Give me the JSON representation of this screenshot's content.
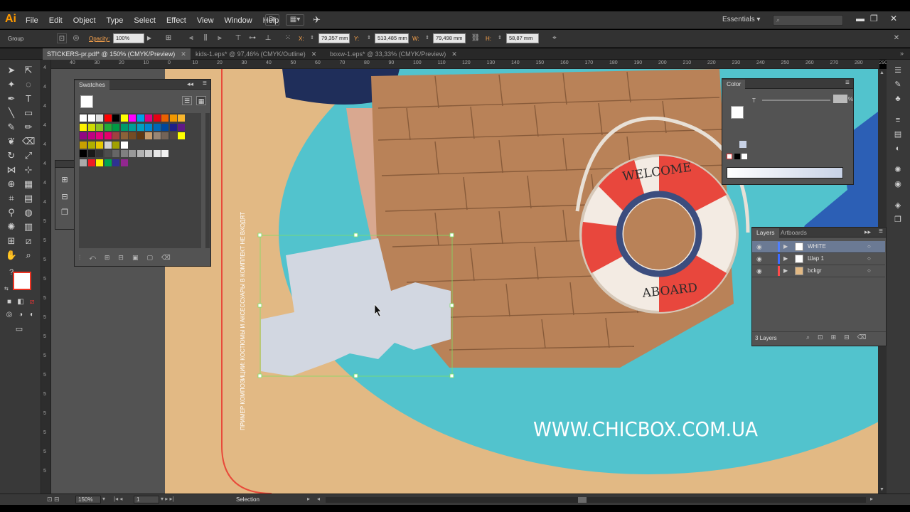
{
  "app": {
    "logo": "Ai",
    "menus": [
      "File",
      "Edit",
      "Object",
      "Type",
      "Select",
      "Effect",
      "View",
      "Window",
      "Help"
    ],
    "workspace": "Essentials",
    "workspace_chevron": "▾",
    "search_icon": "search-icon",
    "window_controls": {
      "minimize": "▬",
      "maximize": "❐",
      "close": "✕"
    }
  },
  "control_bar": {
    "selection_label": "Group",
    "opacity_label": "Opacity:",
    "opacity_value": "100%",
    "x_label": "X:",
    "x_value": "79,357 mm",
    "y_label": "Y:",
    "y_value": "513,485 mm",
    "w_label": "W:",
    "w_value": "79,498 mm",
    "h_label": "H:",
    "h_value": "58,87 mm",
    "close_icon": "✕"
  },
  "tabs": [
    {
      "label": "STICKERS-pr.pdf* @ 150% (CMYK/Preview)",
      "active": true
    },
    {
      "label": "kids-1.eps* @ 97,46% (CMYK/Outline)",
      "active": false
    },
    {
      "label": "boxw-1.eps* @ 33,33% (CMYK/Preview)",
      "active": false
    }
  ],
  "tab_close": "✕",
  "rulers": {
    "h_ticks": [
      "40",
      "30",
      "20",
      "10",
      "0",
      "10",
      "20",
      "30",
      "40",
      "50",
      "60",
      "70",
      "80",
      "90",
      "100",
      "110",
      "120",
      "130",
      "140",
      "150",
      "160",
      "170",
      "180",
      "190",
      "200",
      "210",
      "220",
      "230",
      "240",
      "250",
      "260",
      "270",
      "280",
      "290"
    ],
    "v_ticks": [
      "4",
      "4",
      "4",
      "4",
      "4",
      "4",
      "4",
      "4",
      "5",
      "5",
      "5",
      "5",
      "5",
      "5",
      "5",
      "5",
      "5",
      "5",
      "5",
      "5",
      "5",
      "5"
    ]
  },
  "artwork": {
    "vertical_text": "ПРИМЕР КОМПОЗИЦИИ: КОСТЮМЫ И АКСЕССУАРЫ В КОМПЛЕКТ НЕ ВХОДЯТ",
    "url_text": "WWW.CHICBOX.COM.UA",
    "ring_top": "WELCOME",
    "ring_bottom": "ABOARD",
    "colors": {
      "teal": "#52c3cd",
      "sand": "#e2b984",
      "box": "#b98258",
      "selected_shape": "#d2d7e1",
      "bbox": "#7dde66",
      "ring_red": "#e8473d"
    }
  },
  "swatches": {
    "title": "Swatches",
    "rows": [
      [
        "#ffffff",
        "#ffffff",
        "#dedede",
        "#ff0000",
        "#000000",
        "#ffff00",
        "#ff00ff",
        "#00a0e9",
        "#e4007f",
        "#e60012",
        "#eb6100",
        "#f39800",
        "#f8b62d"
      ],
      [
        "#fff100",
        "#cfdb00",
        "#8fc31f",
        "#22ac38",
        "#009944",
        "#009b6b",
        "#009e96",
        "#00a0c1",
        "#0086d1",
        "#0068b7",
        "#00479d",
        "#1d2088",
        "#601986"
      ],
      [
        "#920783",
        "#be0081",
        "#e4007f",
        "#e5006a",
        "#a04040",
        "#8c6239",
        "#754c24",
        "#603913",
        "#c69c6d",
        "#998675",
        "#736357",
        "#534741",
        "#ffff00"
      ],
      [
        "#c8a000",
        "#b0b000",
        "#e6c800",
        "#d0d0d0",
        "#a0a000",
        "#ffffff"
      ],
      [
        "#000000",
        "#1a1a1a",
        "#333333",
        "#4d4d4d",
        "#666666",
        "#808080",
        "#999999",
        "#b3b3b3",
        "#cccccc",
        "#e6e6e6",
        "#f2f2f2"
      ],
      [
        "#aaaaaa",
        "#ed1c24",
        "#fff200",
        "#00a651",
        "#2e3192",
        "#92278f"
      ]
    ]
  },
  "color_panel": {
    "title": "Color",
    "channel_label": "T",
    "percent": "%"
  },
  "layers_panel": {
    "tabs": [
      "Layers",
      "Artboards"
    ],
    "layers": [
      {
        "name": "WHITE",
        "color": "#4f7fff",
        "selected": true
      },
      {
        "name": "Шар 1",
        "color": "#3d6cff",
        "selected": false
      },
      {
        "name": "bckgr",
        "color": "#ff4b4b",
        "selected": false
      }
    ],
    "count": "3 Layers"
  },
  "status_bar": {
    "zoom": "150%",
    "artboard_num": "1",
    "mode": "Selection"
  }
}
